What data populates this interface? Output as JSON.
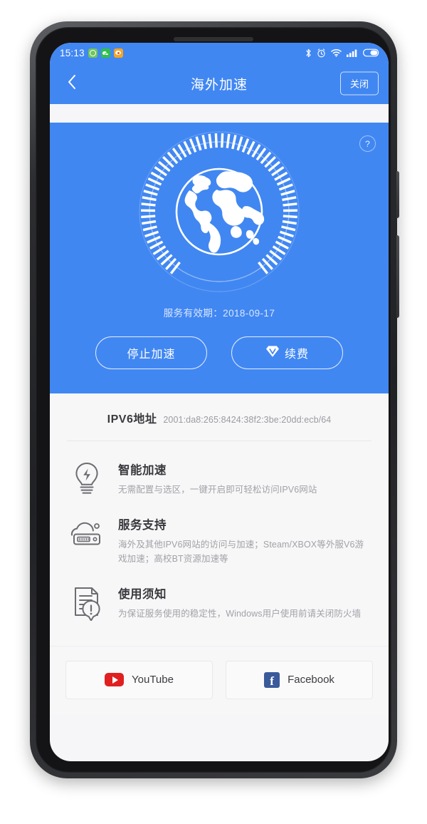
{
  "statusbar": {
    "clock": "15:13",
    "app_icons": [
      "smiley-app-icon",
      "wechat-app-icon",
      "weibo-app-icon"
    ],
    "system_icons": [
      "bluetooth-icon",
      "alarm-icon",
      "wifi-icon",
      "signal-icon",
      "battery-icon"
    ]
  },
  "navbar": {
    "back_icon": "chevron-left-icon",
    "title": "海外加速",
    "close_label": "关闭"
  },
  "hero": {
    "help_label": "?",
    "gauge_icon": "globe-gauge-icon",
    "expiry": "服务有效期：2018-09-17",
    "buttons": [
      {
        "label": "停止加速",
        "icon": null
      },
      {
        "label": "续费",
        "icon": "vip-diamond-icon"
      }
    ],
    "accent_color": "#4187f2"
  },
  "ipv6": {
    "label": "IPV6地址",
    "value": "2001:da8:265:8424:38f2:3be:20dd:ecb/64"
  },
  "features": [
    {
      "icon": "lightbulb-bolt-icon",
      "title": "智能加速",
      "desc": "无需配置与选区，一键开启即可轻松访问IPV6网站"
    },
    {
      "icon": "cloud-server-icon",
      "title": "服务支持",
      "desc": "海外及其他IPV6网站的访问与加速；Steam/XBOX等外服V6游戏加速；高校BT资源加速等"
    },
    {
      "icon": "document-alert-icon",
      "title": "使用须知",
      "desc": "为保证服务使用的稳定性，Windows用户使用前请关闭防火墙"
    }
  ],
  "shortcuts": [
    {
      "label": "YouTube",
      "icon": "youtube-icon",
      "color": "#e02020"
    },
    {
      "label": "Facebook",
      "icon": "facebook-icon",
      "color": "#3a5a9b"
    }
  ]
}
